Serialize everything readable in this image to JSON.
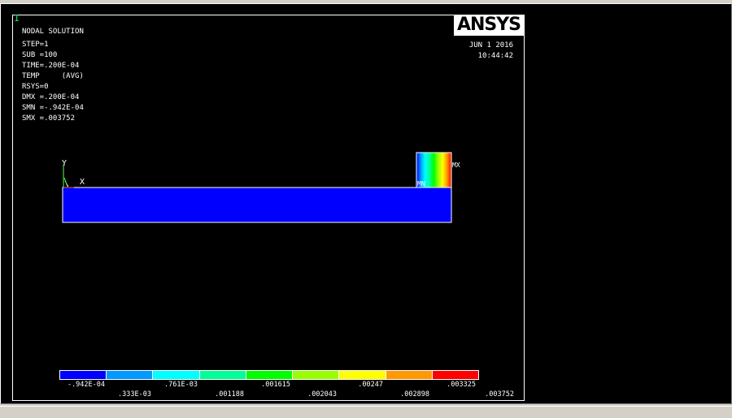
{
  "window_number": "1",
  "logo_text": "ANSYS",
  "info": {
    "title": "NODAL SOLUTION",
    "lines": [
      "STEP=1",
      "SUB =100",
      "TIME=.200E-04",
      "TEMP     (AVG)",
      "RSYS=0",
      "DMX =.200E-04",
      "SMN =-.942E-04",
      "SMX =.003752"
    ]
  },
  "date": "JUN  1 2016",
  "time": "10:44:42",
  "axes": {
    "y_label": "Y",
    "x_label": "X"
  },
  "markers": {
    "max_label": "MX",
    "min_label": "MN"
  },
  "model_colors": {
    "bar_fill": "#0000ff",
    "gradient": [
      "#0000ff",
      "#0099ff",
      "#00ffff",
      "#00ff99",
      "#00ff00",
      "#99ff00",
      "#ffff00",
      "#ff9900",
      "#ff0000"
    ]
  },
  "legend": {
    "colors": [
      "#0000ff",
      "#0099ff",
      "#00ffff",
      "#00ff99",
      "#00ff00",
      "#99ff00",
      "#ffff00",
      "#ff9900",
      "#ff0000"
    ],
    "labels_top": [
      "-.942E-04",
      ".761E-03",
      ".001615",
      ".00247",
      ".003325"
    ],
    "labels_bottom": [
      ".333E-03",
      ".001188",
      ".002043",
      ".002898",
      ".003752"
    ]
  }
}
